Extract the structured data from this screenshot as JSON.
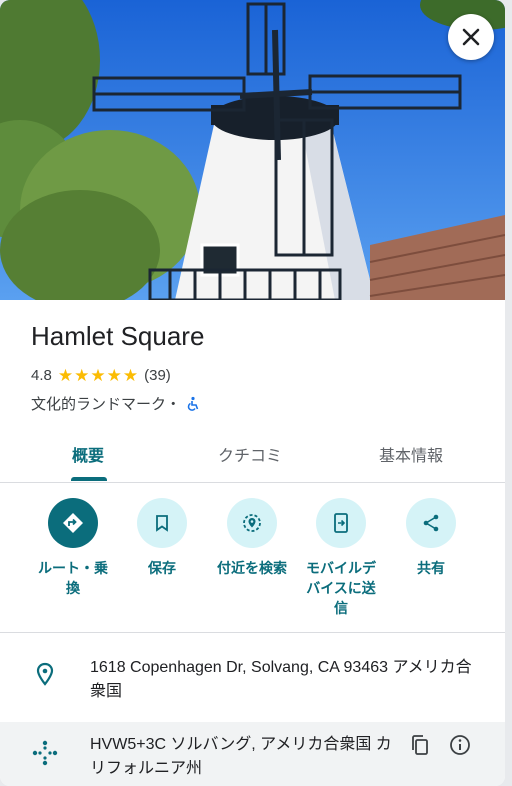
{
  "place": {
    "name": "Hamlet Square",
    "rating": "4.8",
    "stars": 5,
    "review_count": "(39)",
    "category": "文化的ランドマーク・",
    "accessibility_icon": "wheelchair-icon"
  },
  "tabs": [
    {
      "label": "概要",
      "active": true
    },
    {
      "label": "クチコミ",
      "active": false
    },
    {
      "label": "基本情報",
      "active": false
    }
  ],
  "actions": [
    {
      "label": "ルート・乗\n換",
      "icon": "directions-icon"
    },
    {
      "label": "保存",
      "icon": "bookmark-icon"
    },
    {
      "label": "付近を検索",
      "icon": "nearby-icon"
    },
    {
      "label": "モバイルデ\nバイスに送\n信",
      "icon": "send-to-phone-icon"
    },
    {
      "label": "共有",
      "icon": "share-icon"
    }
  ],
  "address": "1618 Copenhagen Dr, Solvang, CA 93463 アメリカ合衆国",
  "plus_code": "HVW5+3C ソルバング, アメリカ合衆国 カリフォルニア州",
  "colors": {
    "accent": "#0b6d7c",
    "action_bg": "#d5f3f7",
    "star": "#fbbc04"
  }
}
